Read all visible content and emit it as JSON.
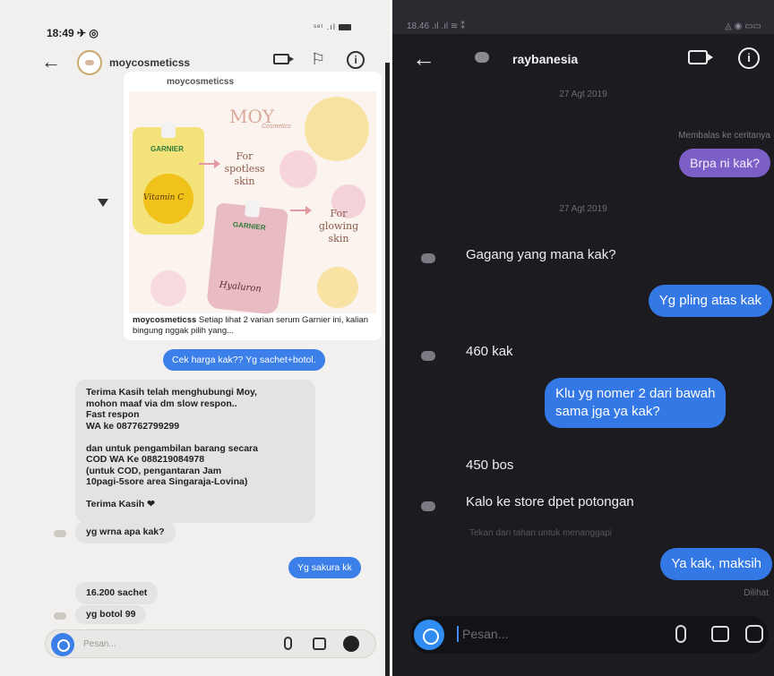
{
  "left": {
    "status": {
      "time": "18:49 ✈ ◎",
      "signal": "ˢᵉᵗ .ıl"
    },
    "header": {
      "username": "moycosmeticss"
    },
    "post": {
      "username": "moycosmeticss",
      "brand": "MOY",
      "brand_sub": "Cosmetics",
      "product1_label": "GARNIER",
      "product1_name": "Vitamin C",
      "product1_caption": "For spotless skin",
      "product2_label": "GARNIER",
      "product2_name": "Hyaluron",
      "product2_caption": "For glowing skin",
      "caption_user": "moycosmeticss",
      "caption_text": " Setiap lihat 2 varian serum Garnier ini, kalian bingung nggak pilih yang..."
    },
    "messages": [
      {
        "text": "Cek harga kak?? Yg sachet+botol."
      },
      {
        "text": "Terima Kasih telah menghubungi Moy,\nmohon maaf via dm slow respon..\nFast respon\nWA ke 087762799299\n\ndan untuk pengambilan barang secara\nCOD WA Ke 088219084978\n(untuk COD, pengantaran Jam\n10pagi-5sore area Singaraja-Lovina)\n\nTerima Kasih ❤"
      },
      {
        "text": "yg wrna apa kak?"
      },
      {
        "text": "Yg sakura kk"
      },
      {
        "text": "16.200 sachet"
      },
      {
        "text": "yg botol 99"
      }
    ],
    "input_placeholder": "Pesan..."
  },
  "right": {
    "status": {
      "time": "18.46 .ıl .ıl ≋ ⁑",
      "right": "◬ ◉ ▭▭"
    },
    "header": {
      "username": "raybanesia"
    },
    "date1": "27 Agt 2019",
    "reply_note": "Membalas ke ceritanya",
    "date2": "27 Agt 2019",
    "messages": [
      {
        "text": "Brpa ni kak?"
      },
      {
        "text": "Gagang yang mana kak?"
      },
      {
        "text": "Yg pling atas kak"
      },
      {
        "text": "460 kak"
      },
      {
        "text": "Klu yg nomer 2 dari bawah\nsama jga ya kak?"
      },
      {
        "text": "450 bos"
      },
      {
        "text": "Kalo ke store dpet potongan"
      },
      {
        "text": "Ya kak, maksih"
      }
    ],
    "hint": "Tekan dan tahan untuk menanggapi",
    "seen": "Dilihat",
    "input_placeholder": "Pesan..."
  },
  "colors": {
    "left_bubble_blue": "#3d7fe9",
    "right_bubble_blue": "#3478e6",
    "right_bubble_purple": "#7b5fc7",
    "right_background": "#1c1b20"
  }
}
